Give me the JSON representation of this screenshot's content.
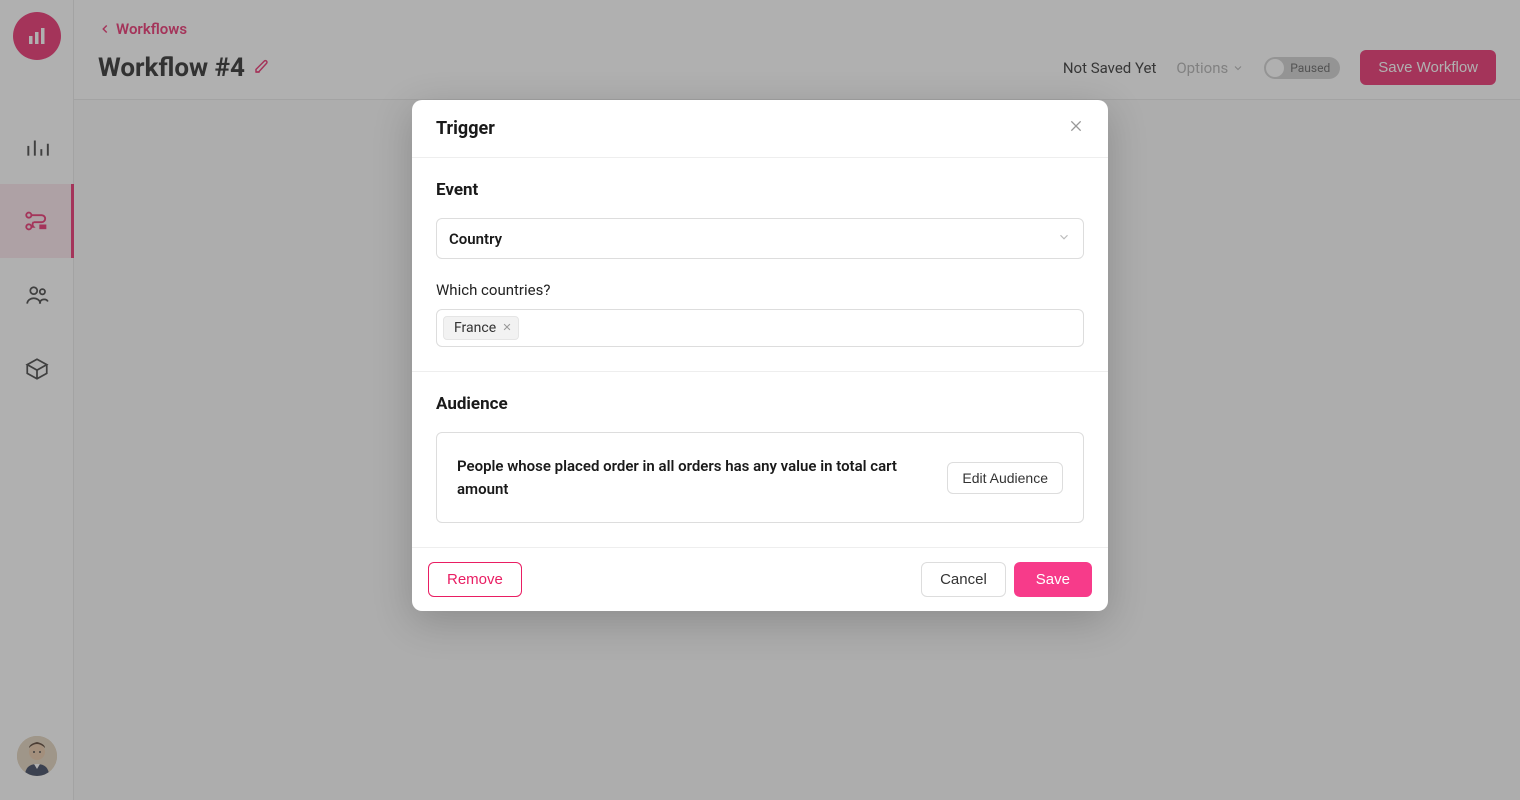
{
  "breadcrumb": {
    "label": "Workflows"
  },
  "page": {
    "title": "Workflow #4",
    "status_text": "Not Saved Yet",
    "options_label": "Options",
    "toggle_label": "Paused",
    "save_button": "Save Workflow"
  },
  "modal": {
    "title": "Trigger",
    "event": {
      "section_title": "Event",
      "select_value": "Country",
      "field_label": "Which countries?",
      "tags": [
        "France"
      ]
    },
    "audience": {
      "section_title": "Audience",
      "description": "People whose placed order in all orders has any value in total cart amount",
      "edit_button": "Edit Audience"
    },
    "footer": {
      "remove": "Remove",
      "cancel": "Cancel",
      "save": "Save"
    }
  }
}
